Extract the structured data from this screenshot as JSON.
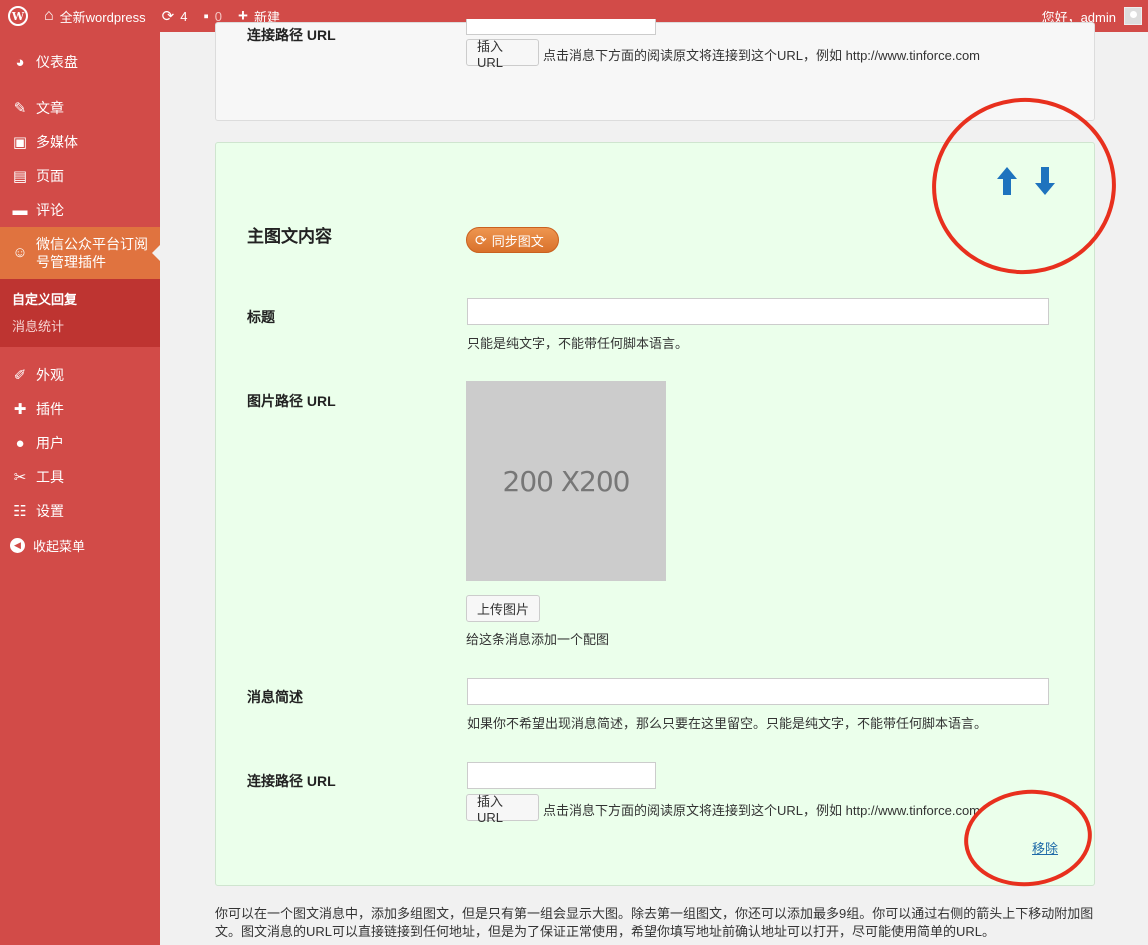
{
  "adminbar": {
    "site_name": "全新wordpress",
    "updates_count": "4",
    "comments_count": "0",
    "new_label": "新建",
    "greeting": "您好，admin",
    "wp_logo_icon": "wordpress-icon",
    "home_icon": "home-icon",
    "updates_icon": "updates-icon",
    "comments_icon": "comment-icon",
    "new_icon": "plus-icon"
  },
  "sidebar": {
    "items": [
      {
        "label": "仪表盘",
        "icon": "dashboard-icon"
      },
      {
        "label": "文章",
        "icon": "pin-icon"
      },
      {
        "label": "多媒体",
        "icon": "media-icon"
      },
      {
        "label": "页面",
        "icon": "page-icon"
      },
      {
        "label": "评论",
        "icon": "comment-icon"
      },
      {
        "label": "微信公众平台订阅号管理插件",
        "icon": "weixin-icon"
      },
      {
        "label": "外观",
        "icon": "brush-icon"
      },
      {
        "label": "插件",
        "icon": "plugin-icon"
      },
      {
        "label": "用户",
        "icon": "user-icon"
      },
      {
        "label": "工具",
        "icon": "wrench-icon"
      },
      {
        "label": "设置",
        "icon": "settings-icon"
      }
    ],
    "submenu": [
      {
        "label": "自定义回复",
        "active": true
      },
      {
        "label": "消息统计",
        "active": false
      }
    ],
    "collapse_label": "收起菜单"
  },
  "prev_panel": {
    "url_label": "连接路径 URL",
    "insert_url_button": "插入URL",
    "url_help": "点击消息下方面的阅读原文将连接到这个URL，例如 http://www.tinforce.com"
  },
  "main_panel": {
    "section_title": "主图文内容",
    "sync_button": "同步图文",
    "title_label": "标题",
    "title_value": "",
    "title_help": "只能是纯文字，不能带任何脚本语言。",
    "image_label": "图片路径 URL",
    "image_placeholder": "200 X200",
    "upload_button": "上传图片",
    "image_help": "给这条消息添加一个配图",
    "summary_label": "消息简述",
    "summary_value": "",
    "summary_help": "如果你不希望出现消息简述，那么只要在这里留空。只能是纯文字，不能带任何脚本语言。",
    "url_label": "连接路径 URL",
    "url_value": "",
    "insert_url_button": "插入URL",
    "url_help": "点击消息下方面的阅读原文将连接到这个URL，例如 http://www.tinforce.com",
    "remove_link": "移除",
    "move_up_icon": "arrow-up-icon",
    "move_down_icon": "arrow-down-icon"
  },
  "footer_note": "你可以在一个图文消息中，添加多组图文，但是只有第一组会显示大图。除去第一组图文，你还可以添加最多9组。你可以通过右侧的箭头上下移动附加图文。图文消息的URL可以直接链接到任何地址，但是为了保证正常使用，希望你填写地址前确认地址可以打开，尽可能使用简单的URL。",
  "colors": {
    "sidebar": "#d24b48",
    "sidebar_current": "#e0733f",
    "panel_bg": "#ebffeb",
    "arrow": "#1e73be",
    "annotation": "#e8301e"
  }
}
